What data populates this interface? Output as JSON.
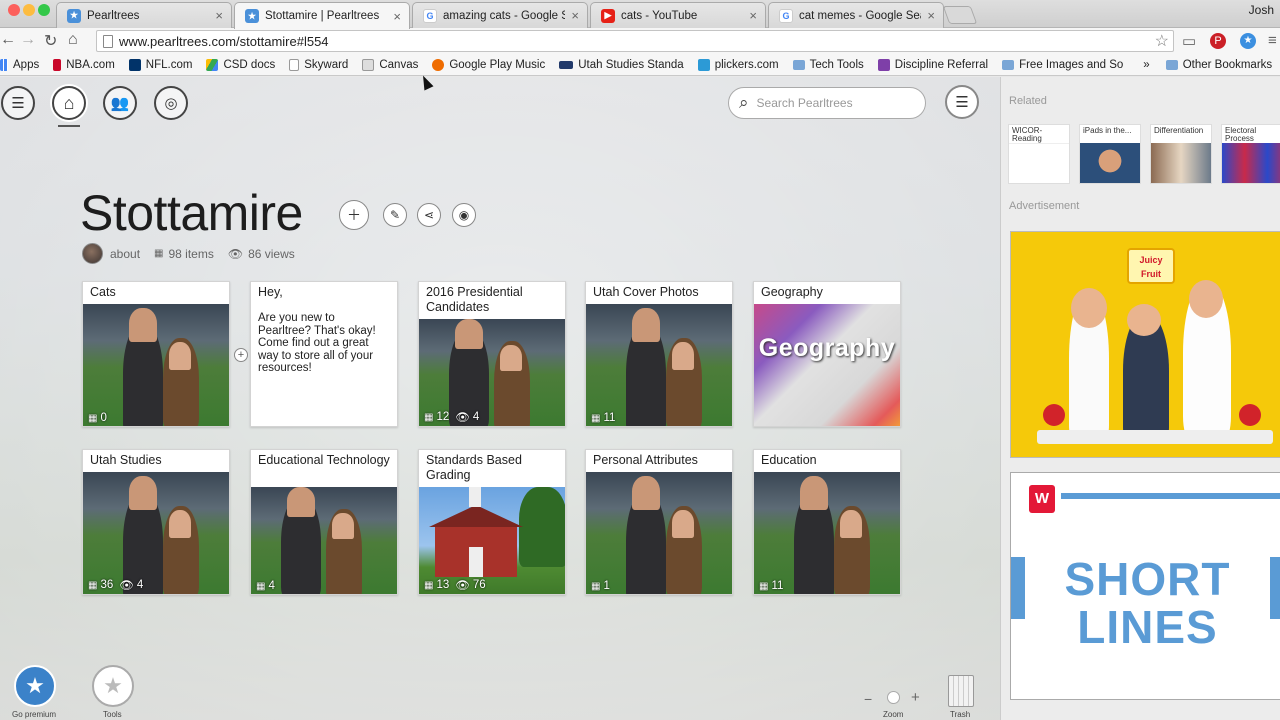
{
  "browser": {
    "tabs": [
      {
        "title": "Pearltrees",
        "icon": "pearltrees-icon",
        "color": "#4a90d9"
      },
      {
        "title": "Stottamire | Pearltrees",
        "icon": "pearltrees-icon",
        "color": "#4a90d9"
      },
      {
        "title": "amazing cats - Google Sea",
        "icon": "google-icon",
        "color": "#4285f4"
      },
      {
        "title": "cats - YouTube",
        "icon": "youtube-icon",
        "color": "#e62117"
      },
      {
        "title": "cat memes - Google Searc",
        "icon": "google-icon",
        "color": "#4285f4"
      }
    ],
    "user": "Josh",
    "url": "www.pearltrees.com/stottamire#l554",
    "bookmarks": [
      "Apps",
      "NBA.com",
      "NFL.com",
      "CSD docs",
      "Skyward",
      "Canvas",
      "Google Play Music",
      "Utah Studies Standa",
      "plickers.com",
      "Tech Tools",
      "Discipline Referral",
      "Free Images and So"
    ],
    "bookmarks_more": "»",
    "other_bookmarks": "Other Bookmarks"
  },
  "page": {
    "search_placeholder": "Search Pearltrees",
    "title": "Stottamire",
    "about": "about",
    "items": "98 items",
    "views": "86 views",
    "cards_row1": [
      {
        "title": "Cats",
        "items": "0",
        "views": ""
      },
      {
        "title": "Hey,",
        "note": "Are you new to Pearltree?  That's okay!  Come find out a great way to store all of your resources!"
      },
      {
        "title": "2016 Presidential Candidates",
        "items": "12",
        "views": "4"
      },
      {
        "title": "Utah Cover Photos",
        "items": "11",
        "views": ""
      },
      {
        "title": "Geography",
        "image_text": "Geography"
      }
    ],
    "cards_row2": [
      {
        "title": "Utah Studies",
        "items": "36",
        "views": "4"
      },
      {
        "title": "Educational Technology",
        "items": "4",
        "views": ""
      },
      {
        "title": "Standards Based Grading",
        "items": "13",
        "views": "76"
      },
      {
        "title": "Personal Attributes",
        "items": "1",
        "views": ""
      },
      {
        "title": "Education",
        "items": "11",
        "views": ""
      }
    ],
    "go_premium": "Go premium",
    "tools": "Tools",
    "zoom": "Zoom",
    "trash": "Trash"
  },
  "right": {
    "related": "Related",
    "related_items": [
      "WICOR-Reading",
      "iPads in the...",
      "Differentiation",
      "Electoral Process"
    ],
    "advertisement": "Advertisement",
    "ad1_brand": "Juicy Fruit",
    "ad2_text_line1": "SHORT",
    "ad2_text_line2": "LINES"
  }
}
